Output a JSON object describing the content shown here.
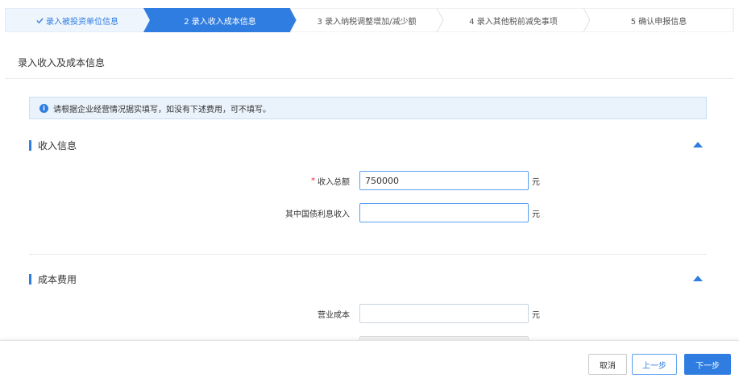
{
  "steps": [
    {
      "label": "录入被投资单位信息",
      "state": "done"
    },
    {
      "label": "2 录入收入成本信息",
      "state": "active"
    },
    {
      "label": "3 录入纳税调整增加/减少额",
      "state": "pending"
    },
    {
      "label": "4 录入其他税前减免事项",
      "state": "pending"
    },
    {
      "label": "5 确认申报信息",
      "state": "pending"
    }
  ],
  "card": {
    "title": "录入收入及成本信息",
    "notice": "请根据企业经营情况据实填写，如没有下述费用，可不填写。"
  },
  "income": {
    "title": "收入信息",
    "total_label": "收入总额",
    "total_value": "750000",
    "total_unit": "元",
    "bond_label": "其中国债利息收入",
    "bond_value": "",
    "bond_unit": "元"
  },
  "cost": {
    "title": "成本费用",
    "operating_label": "营业成本",
    "operating_value": "",
    "operating_unit": "元",
    "next_value": ""
  },
  "footer": {
    "cancel_label": "取消",
    "prev_label": "上一步",
    "next_label": "下一步"
  },
  "colors": {
    "accent": "#2f7de1",
    "required": "#f5222d",
    "notice_bg": "#eaf3fc"
  }
}
